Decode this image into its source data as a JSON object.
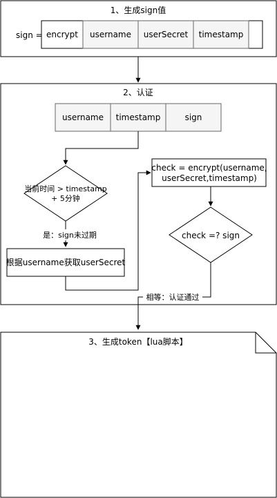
{
  "section1": {
    "title": "1、生成sign值",
    "sign_label": "sign =",
    "cells": [
      "encrypt",
      "username",
      "userSecret",
      "timestamp"
    ]
  },
  "section2": {
    "title": "2、认证",
    "cells": [
      "username",
      "timestamp",
      "sign"
    ],
    "decision_time": [
      "当前时间 > timestamp",
      "+ 5分钟"
    ],
    "edge_not_expired": "是：sign未过期",
    "fetch_secret": "根据username获取userSecret",
    "compute_check": [
      "check = encrypt(username,",
      "userSecret,timestamp)"
    ],
    "decision_check": "check =? sign",
    "edge_equal": "相等：认证通过"
  },
  "section3": {
    "title": "3、生成token【lua脚本】"
  },
  "colors": {
    "stroke": "#000000",
    "cell_fill": "#f5f5f5",
    "cell_stroke": "#666666",
    "background": "#ffffff"
  }
}
